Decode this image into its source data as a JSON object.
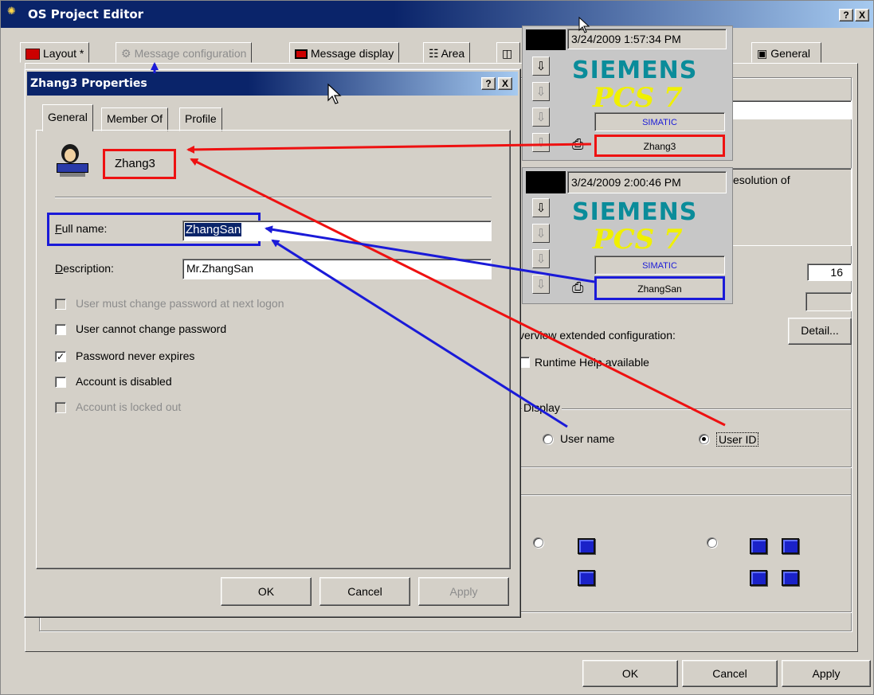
{
  "main_window": {
    "title": "OS Project Editor",
    "help_btn": "?",
    "close_btn": "X",
    "tabs": [
      "Layout *",
      "Message configuration",
      "Message display",
      "Area",
      "General"
    ],
    "partial_texts": {
      "resolution": "esolution of",
      "number_value": "16",
      "extended_config": "verview extended configuration:",
      "detail_btn": "Detail...",
      "runtime_help": "Runtime Help available",
      "display_group": "Display",
      "radio_user_name": "User name",
      "radio_user_id": "User ID"
    },
    "buttons": {
      "ok": "OK",
      "cancel": "Cancel",
      "apply": "Apply"
    }
  },
  "dialog": {
    "title": "Zhang3 Properties",
    "help_btn": "?",
    "close_btn": "X",
    "tabs": [
      "General",
      "Member Of",
      "Profile"
    ],
    "user_name": "Zhang3",
    "full_name_label": "Full name:",
    "full_name_value": "ZhangSan",
    "description_label": "Description:",
    "description_value": "Mr.ZhangSan",
    "checkboxes": [
      {
        "label": "User must change password at next logon",
        "checked": false,
        "enabled": false
      },
      {
        "label": "User cannot change password",
        "checked": false,
        "enabled": true
      },
      {
        "label": "Password never expires",
        "checked": true,
        "enabled": true
      },
      {
        "label": "Account is disabled",
        "checked": false,
        "enabled": true
      },
      {
        "label": "Account is locked out",
        "checked": false,
        "enabled": false
      }
    ],
    "buttons": {
      "ok": "OK",
      "cancel": "Cancel",
      "apply": "Apply"
    }
  },
  "pcs_panel_1": {
    "datetime": "3/24/2009 1:57:34 PM",
    "brand": "SIEMENS",
    "product": "PCS 7",
    "simatic": "SIMATIC",
    "user": "Zhang3"
  },
  "pcs_panel_2": {
    "datetime": "3/24/2009 2:00:46 PM",
    "brand": "SIEMENS",
    "product": "PCS 7",
    "simatic": "SIMATIC",
    "user": "ZhangSan"
  },
  "colors": {
    "annotation_red": "#ee1111",
    "annotation_blue": "#1a1ad8",
    "siemens_teal": "#0a8c9a",
    "pcs7_yellow": "#f0f000"
  }
}
